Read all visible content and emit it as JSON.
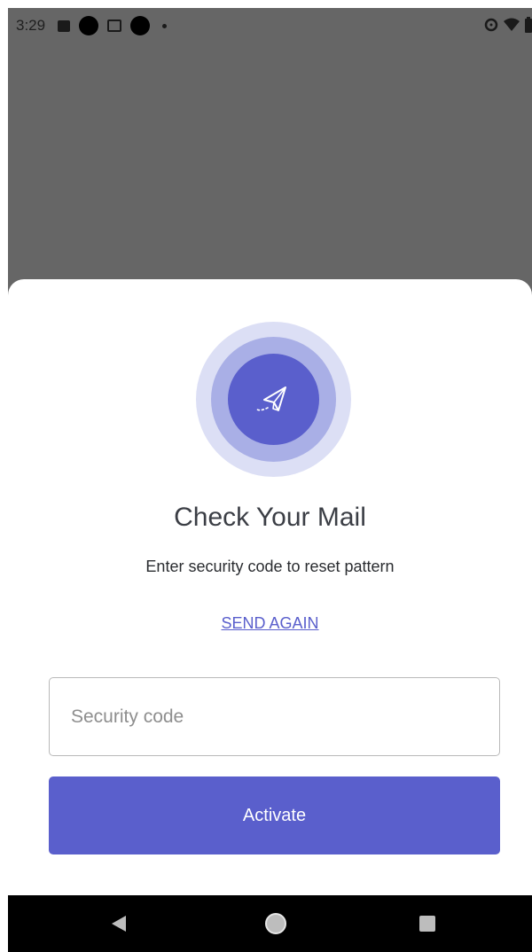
{
  "status_bar": {
    "time": "3:29",
    "left_icons": [
      "image-icon",
      "notification-dot-icon",
      "gmail-icon",
      "notification-dot-icon",
      "more-dot-icon"
    ],
    "right_icons": [
      "data-saver-icon",
      "wifi-icon",
      "battery-icon"
    ]
  },
  "dialog": {
    "title": "Check Your Mail",
    "subtitle": "Enter security code to reset pattern",
    "send_again_label": "SEND AGAIN",
    "security_code": {
      "value": "",
      "placeholder": "Security code"
    },
    "activate_label": "Activate",
    "icon": "paper-plane-icon"
  },
  "nav_bar": {
    "buttons": [
      "back-icon",
      "home-icon",
      "recents-icon"
    ]
  },
  "colors": {
    "accent": "#5a5fcc",
    "ring_mid": "#a9afe6",
    "ring_outer": "#dcdff5",
    "scrim": "#666666"
  }
}
